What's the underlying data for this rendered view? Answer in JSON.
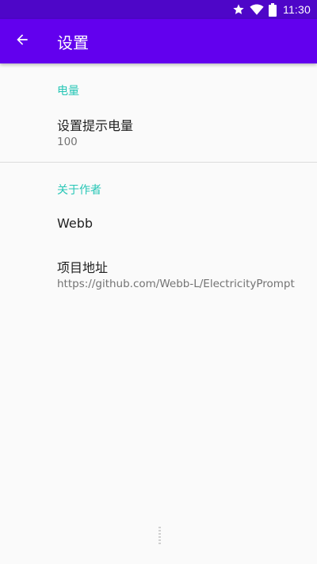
{
  "status_bar": {
    "time": "11:30",
    "icons": [
      "star-icon",
      "wifi-icon",
      "battery-icon"
    ]
  },
  "app_bar": {
    "back_icon": "arrow-back-icon",
    "title": "设置"
  },
  "sections": {
    "battery": {
      "category": "电量",
      "reminder": {
        "title": "设置提示电量",
        "summary": "100"
      }
    },
    "about": {
      "category": "关于作者",
      "author": {
        "title": "Webb"
      },
      "project": {
        "title": "项目地址",
        "summary": "https://github.com/Webb-L/ElectricityPrompt"
      }
    }
  },
  "colors": {
    "status_bar": "#4e06c8",
    "app_bar": "#6200ee",
    "accent": "#26c6b6",
    "background": "#fafafa"
  }
}
